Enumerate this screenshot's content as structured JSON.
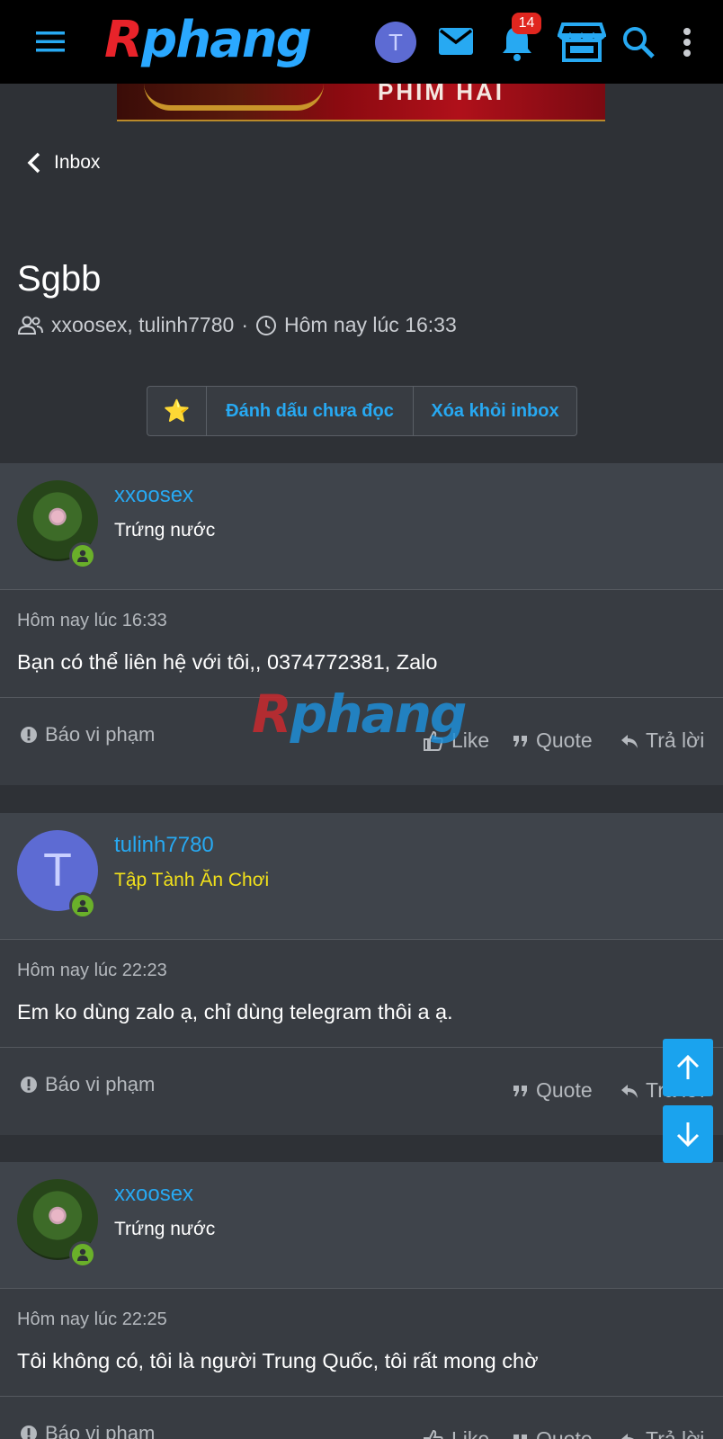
{
  "header": {
    "logo_text_red": "R",
    "logo_text_blue": "phang",
    "avatar_letter": "T",
    "notification_count": "14",
    "icons": [
      "menu-icon",
      "mail-icon",
      "bell-icon",
      "store-icon",
      "search-icon",
      "more-vertical-icon"
    ]
  },
  "banner": {
    "text": "PHIM HAI"
  },
  "nav": {
    "back_label": "Inbox"
  },
  "conversation": {
    "title": "Sgbb",
    "participants": "xxoosex, tulinh7780",
    "separator": "·",
    "time": "Hôm nay lúc 16:33"
  },
  "buttons": {
    "star": "⭐",
    "mark_unread": "Đánh dấu chưa đọc",
    "remove": "Xóa khỏi inbox"
  },
  "watermark": {
    "red": "R",
    "blue": "phang"
  },
  "messages": [
    {
      "username": "xxoosex",
      "user_title": "Trứng nước",
      "time": "Hôm nay lúc 16:33",
      "body": "Bạn có thể liên hệ với tôi,,  0374772381, Zalo",
      "report": "Báo vi phạm",
      "like": "Like",
      "quote": "Quote",
      "reply": "Trả lời"
    },
    {
      "username": "tulinh7780",
      "avatar_letter": "T",
      "user_title": "Tập Tành Ăn Chơi",
      "time": "Hôm nay lúc 22:23",
      "body": "Em ko dùng zalo ạ, chỉ dùng telegram thôi a ạ.",
      "report": "Báo vi phạm",
      "quote": "Quote",
      "reply": "Trả lời"
    },
    {
      "username": "xxoosex",
      "user_title": "Trứng nước",
      "time": "Hôm nay lúc 22:25",
      "body": "Tôi không có, tôi là người Trung Quốc, tôi rất mong chờ",
      "report": "Báo vi phạm",
      "like": "Like",
      "quote": "Quote",
      "reply": "Trả lời"
    }
  ],
  "colors": {
    "accent": "#27a9f2",
    "background": "#2e3136",
    "header_bg": "#000000",
    "online": "#6ab02a",
    "badge": "#e0261f",
    "title_yellow": "#f2e11a"
  }
}
